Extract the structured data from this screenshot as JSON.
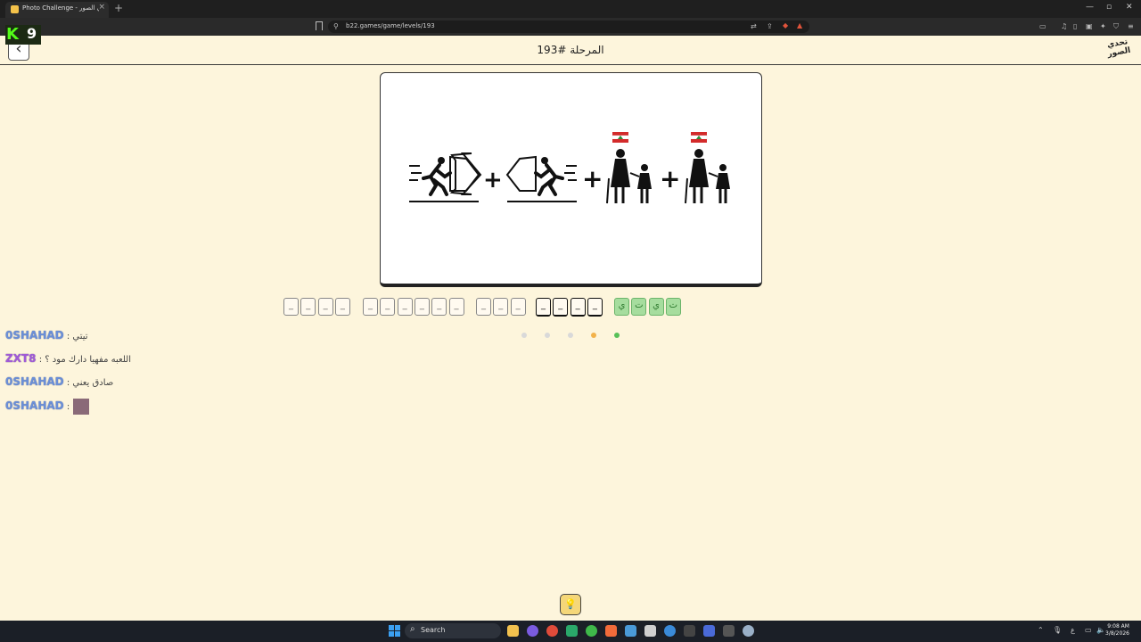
{
  "browser": {
    "tab_title": "Photo Challenge - تحدي الصور",
    "url": "b22.games/game/levels/193",
    "new_tab": "+",
    "tab_close": "×",
    "minimize": "—",
    "restore": "▫",
    "close": "✕"
  },
  "stream_overlay": {
    "k": "K",
    "count": "9"
  },
  "header": {
    "back": "‹",
    "level_title": "المرحلة #193",
    "logo": "تحدي الصور"
  },
  "puzzle": {
    "plus": "+",
    "pictures": [
      "running-exit-right-icon",
      "running-exit-left-icon",
      "grandmother-child-lebanon-icon",
      "grandmother-child-lebanon-icon"
    ]
  },
  "answer": {
    "words": [
      {
        "letters": [
          "_",
          "_",
          "_",
          "_"
        ],
        "state": "empty"
      },
      {
        "letters": [
          "_",
          "_",
          "_",
          "_",
          "_",
          "_"
        ],
        "state": "empty"
      },
      {
        "letters": [
          "_",
          "_",
          "_"
        ],
        "state": "empty"
      },
      {
        "letters": [
          "_",
          "_",
          "_",
          "_"
        ],
        "state": "active"
      },
      {
        "letters": [
          "ي",
          "ت",
          "ي",
          "ت"
        ],
        "state": "solved"
      }
    ],
    "dots": [
      "#d9d9d9",
      "#d9d9d9",
      "#d9d9d9",
      "#f2b24a",
      "#58c058"
    ]
  },
  "chat": [
    {
      "user": "0SHAHAD",
      "message": ": تيتي",
      "color": "blue"
    },
    {
      "user": "ZXT8",
      "message": ": اللعبه مفهيا دارك مود ؟",
      "color": "purple"
    },
    {
      "user": "0SHAHAD",
      "message": ": صادق يعني",
      "color": "blue"
    },
    {
      "user": "0SHAHAD",
      "message": ":",
      "color": "blue",
      "emote": true
    }
  ],
  "hint_icon": "lightbulb-icon",
  "taskbar": {
    "search": "Search",
    "time": "9:08 AM",
    "date": "3/8/2026",
    "lang": "ع"
  }
}
